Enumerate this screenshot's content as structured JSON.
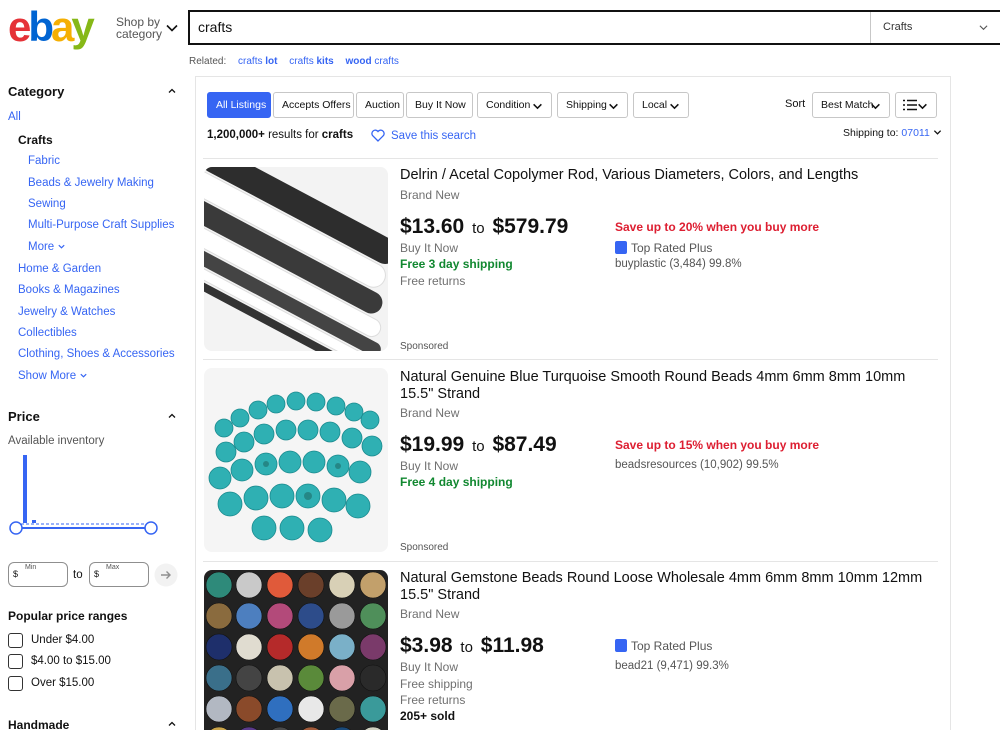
{
  "header": {
    "logo": {
      "e": "e",
      "b": "b",
      "a": "a",
      "y": "y"
    },
    "shop_by_category": "Shop by category",
    "search_value": "crafts",
    "search_category": "Crafts"
  },
  "related": {
    "label": "Related:",
    "links": [
      {
        "pre": "crafts ",
        "bold": "lot"
      },
      {
        "pre": "crafts ",
        "bold": "kits"
      },
      {
        "pre": "",
        "bold": "wood",
        "post": " crafts"
      }
    ]
  },
  "sidebar": {
    "category_heading": "Category",
    "all": "All",
    "selected": "Crafts",
    "sub_items": [
      "Fabric",
      "Beads & Jewelry Making",
      "Sewing",
      "Multi-Purpose Craft Supplies"
    ],
    "more": "More",
    "other_categories": [
      "Home & Garden",
      "Books & Magazines",
      "Jewelry & Watches",
      "Collectibles",
      "Clothing, Shoes & Accessories"
    ],
    "show_more": "Show More",
    "price_heading": "Price",
    "available_inventory": "Available inventory",
    "min_label": "Min",
    "max_label": "Max",
    "currency": "$",
    "to": "to",
    "popular_heading": "Popular price ranges",
    "ranges": [
      "Under $4.00",
      "$4.00 to $15.00",
      "Over $15.00"
    ],
    "handmade_heading": "Handmade"
  },
  "toolbar": {
    "tabs": [
      "All Listings",
      "Accepts Offers",
      "Auction",
      "Buy It Now"
    ],
    "filters": [
      "Condition",
      "Shipping",
      "Local"
    ],
    "sort_label": "Sort",
    "sort_value": "Best Match"
  },
  "summary": {
    "count": "1,200,000+",
    "results_for": " results for ",
    "query": "crafts",
    "save_search": "Save this search",
    "shipping_to_label": "Shipping to: ",
    "zip": "07011"
  },
  "listings": [
    {
      "title": "Delrin / Acetal Copolymer Rod, Various Diameters, Colors, and Lengths",
      "condition": "Brand New",
      "price_low": "$13.60",
      "price_to": "to",
      "price_high": "$579.79",
      "buy_format": "Buy It Now",
      "shipping": "Free 3 day shipping",
      "returns": "Free returns",
      "promo": "Save up to 20% when you buy more",
      "top_rated": "Top Rated Plus",
      "seller": "buyplastic (3,484) 99.8%",
      "sponsored": "Sponsored"
    },
    {
      "title": "Natural Genuine Blue Turquoise Smooth Round Beads 4mm 6mm 8mm 10mm 15.5\" Strand",
      "condition": "Brand New",
      "price_low": "$19.99",
      "price_to": "to",
      "price_high": "$87.49",
      "buy_format": "Buy It Now",
      "shipping": "Free 4 day shipping",
      "promo": "Save up to 15% when you buy more",
      "seller": "beadsresources (10,902) 99.5%",
      "sponsored": "Sponsored"
    },
    {
      "title": "Natural Gemstone Beads Round Loose Wholesale 4mm 6mm 8mm 10mm 12mm 15.5\" Strand",
      "condition": "Brand New",
      "price_low": "$3.98",
      "price_to": "to",
      "price_high": "$11.98",
      "buy_format": "Buy It Now",
      "shipping": "Free shipping",
      "returns": "Free returns",
      "sold": "205+ sold",
      "top_rated": "Top Rated Plus",
      "seller": "bead21 (9,471) 99.3%"
    }
  ],
  "colors": {
    "link_blue": "#3665f3",
    "promo_red": "#dd1e31",
    "shipping_green": "#118830",
    "logo_red": "#e53238",
    "logo_blue": "#0064d2",
    "logo_yellow": "#f5af02",
    "logo_green": "#86b817"
  }
}
